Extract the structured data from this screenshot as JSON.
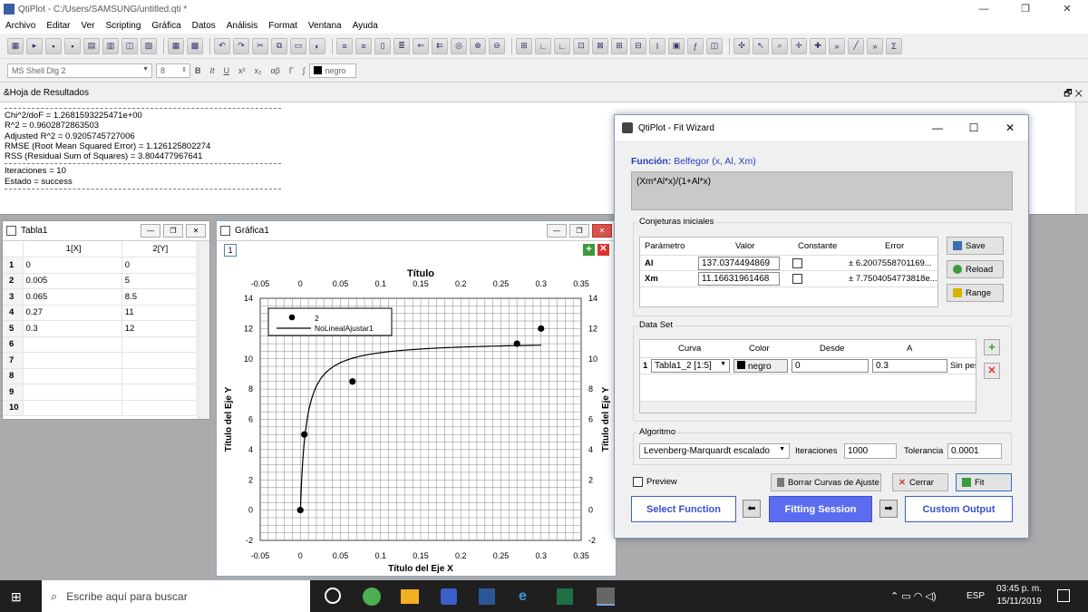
{
  "app": {
    "title": "QtiPlot - C:/Users/SAMSUNG/untitled.qti *"
  },
  "menu": [
    "Archivo",
    "Editar",
    "Ver",
    "Scripting",
    "Gráfica",
    "Datos",
    "Análisis",
    "Format",
    "Ventana",
    "Ayuda"
  ],
  "format": {
    "font": "MS Shell Dlg 2",
    "size": "8",
    "bold": "B",
    "italic": "It",
    "underline": "U",
    "sup": "x²",
    "sub": "x₂",
    "color": "negro"
  },
  "results": {
    "title": "&Hoja de Resultados",
    "lines": [
      "Chi^2/doF = 1.2681593225471e+00",
      "R^2 = 0.9602872863503",
      "Adjusted R^2 = 0.9205745727006",
      "RMSE (Root Mean Squared Error) = 1.126125802274",
      "RSS (Residual Sum of Squares) = 3.804477967641"
    ],
    "iter": "Iteraciones = 10",
    "status": "Estado = success"
  },
  "tabla": {
    "title": "Tabla1",
    "col1": "1[X]",
    "col2": "2[Y]",
    "rows": [
      [
        "1",
        "0",
        "0"
      ],
      [
        "2",
        "0.005",
        "5"
      ],
      [
        "3",
        "0.065",
        "8.5"
      ],
      [
        "4",
        "0.27",
        "11"
      ],
      [
        "5",
        "0.3",
        "12"
      ],
      [
        "6",
        "",
        ""
      ],
      [
        "7",
        "",
        ""
      ],
      [
        "8",
        "",
        ""
      ],
      [
        "9",
        "",
        ""
      ],
      [
        "10",
        "",
        ""
      ]
    ]
  },
  "grafica": {
    "title": "Gráfica1",
    "layer": "1"
  },
  "chart_data": {
    "type": "scatter",
    "title": "Título",
    "xlabel": "Título del Eje X",
    "ylabel": "Título del Eje Y",
    "xlim": [
      -0.05,
      0.35
    ],
    "ylim": [
      -2,
      14
    ],
    "xticks": [
      "-0.05",
      "0",
      "0.05",
      "0.1",
      "0.15",
      "0.2",
      "0.25",
      "0.3",
      "0.35"
    ],
    "yticks": [
      "-2",
      "0",
      "2",
      "4",
      "6",
      "8",
      "10",
      "12",
      "14"
    ],
    "series": [
      {
        "name": "2",
        "x": [
          0,
          0.005,
          0.065,
          0.27,
          0.3
        ],
        "y": [
          0,
          5,
          8.5,
          11,
          12
        ]
      },
      {
        "name": "NoLinealAjustar1",
        "model": "Belfegor",
        "params": {
          "Al": 137.0374494869,
          "Xm": 11.16631961468
        },
        "x_range": [
          0,
          0.3
        ]
      }
    ],
    "legend": "top-left",
    "grid": true
  },
  "fit": {
    "title": "QtiPlot - Fit Wizard",
    "func_label": "Función:",
    "func_name": "Belfegor (x, Al, Xm)",
    "formula": "(Xm*Al*x)/(1+Al*x)",
    "guesses_label": "Conjeturas iniciales",
    "params_head": [
      "Parámetro",
      "Valor",
      "Constante",
      "Error"
    ],
    "params": [
      {
        "name": "Al",
        "value": "137.0374494869",
        "error": "± 6.2007558701169..."
      },
      {
        "name": "Xm",
        "value": "11.16631961468",
        "error": "± 7.7504054773818e..."
      }
    ],
    "save": "Save",
    "reload": "Reload",
    "range": "Range",
    "dataset_label": "Data Set",
    "ds_head": [
      "Curva",
      "Color",
      "Desde",
      "A"
    ],
    "ds_row": {
      "num": "1",
      "curve": "Tabla1_2 [1:5]",
      "color": "negro",
      "from": "0",
      "to": "0.3",
      "extra": "Sin pes"
    },
    "algo_label": "Algoritmo",
    "algo": "Levenberg-Marquardt escalado",
    "iter_label": "Iteraciones",
    "iter": "1000",
    "tol_label": "Tolerancia",
    "tol": "0.0001",
    "preview": "Preview",
    "clear": "Borrar Curvas de Ajuste",
    "close": "Cerrar",
    "fitbtn": "Fit",
    "select": "Select Function",
    "session": "Fitting Session",
    "output": "Custom Output"
  },
  "taskbar": {
    "search": "Escribe aquí para buscar",
    "lang": "ESP",
    "time": "03:45 p. m.",
    "date": "15/11/2019"
  }
}
